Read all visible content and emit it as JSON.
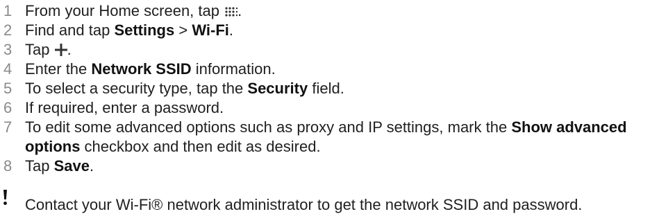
{
  "steps": [
    {
      "number": "1",
      "text_a": "From your Home screen, tap ",
      "icon": "apps-grid-icon",
      "text_b": "."
    },
    {
      "number": "2",
      "text_a": "Find and tap ",
      "bold_a": "Settings",
      "text_b": " > ",
      "bold_b": "Wi-Fi",
      "text_c": "."
    },
    {
      "number": "3",
      "text_a": "Tap ",
      "icon": "plus-icon",
      "text_b": "."
    },
    {
      "number": "4",
      "text_a": "Enter the ",
      "bold_a": "Network SSID",
      "text_b": " information."
    },
    {
      "number": "5",
      "text_a": "To select a security type, tap the ",
      "bold_a": "Security",
      "text_b": " field."
    },
    {
      "number": "6",
      "text_a": "If required, enter a password."
    },
    {
      "number": "7",
      "text_a": "To edit some advanced options such as proxy and IP settings, mark the ",
      "bold_a": "Show advanced options",
      "text_b": " checkbox and then edit as desired."
    },
    {
      "number": "8",
      "text_a": "Tap ",
      "bold_a": "Save",
      "text_b": "."
    }
  ],
  "note": {
    "icon": "exclamation-icon",
    "text": "Contact your Wi-Fi® network administrator to get the network SSID and password."
  }
}
